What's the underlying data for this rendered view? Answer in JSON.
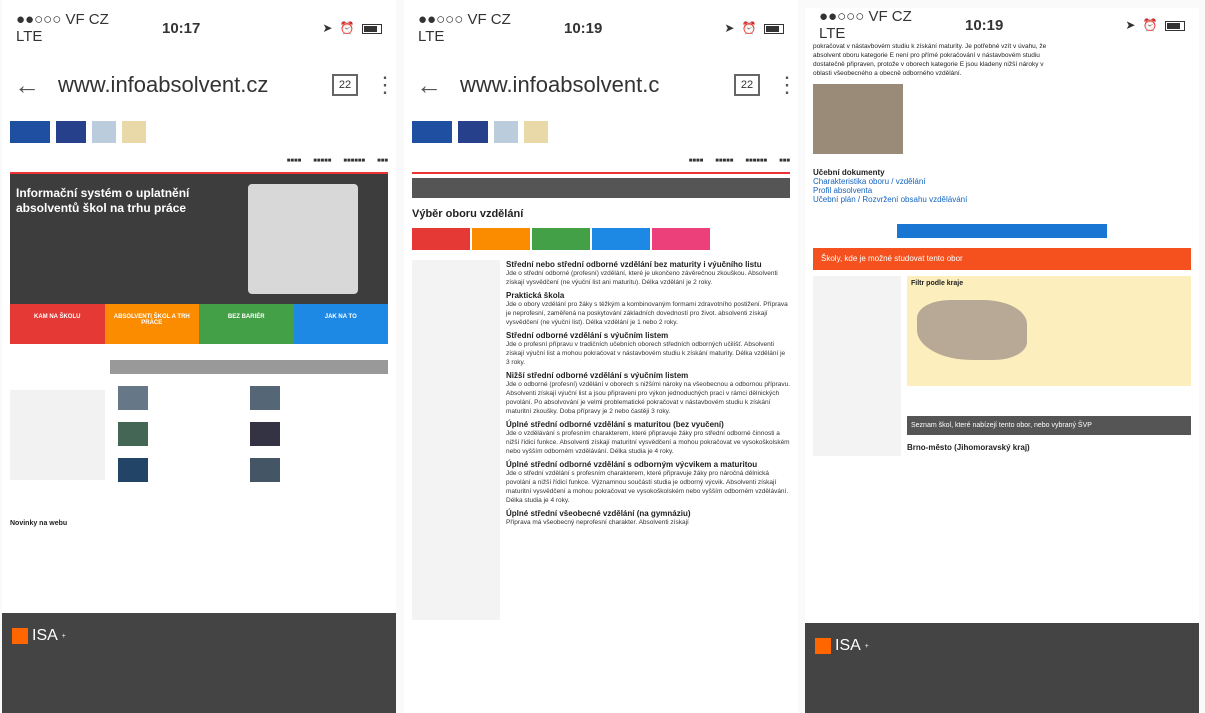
{
  "phones": [
    {
      "status": {
        "carrier": "●●○○○ VF CZ  LTE",
        "time": "10:17"
      },
      "url": "www.infoabsolvent.cz",
      "tabs": "22"
    },
    {
      "status": {
        "carrier": "●●○○○ VF CZ  LTE",
        "time": "10:19"
      },
      "url": "www.infoabsolvent.c",
      "tabs": "22"
    },
    {
      "status": {
        "carrier": "●●○○○ VF CZ  LTE",
        "time": "10:19"
      }
    }
  ],
  "p1": {
    "hero_title": "Informační systém o uplatnění absolventů škol na trhu práce",
    "tiles": [
      {
        "label": "KAM NA ŠKOLU",
        "color": "#e53935"
      },
      {
        "label": "ABSOLVENTI ŠKOL A TRH PRÁCE",
        "color": "#fb8c00"
      },
      {
        "label": "BEZ BARIÉR",
        "color": "#43a047"
      },
      {
        "label": "JAK NA TO",
        "color": "#1e88e5"
      }
    ],
    "news": "Novinky na webu"
  },
  "p2": {
    "heading": "Výběr oboru vzdělání",
    "chips": [
      {
        "color": "#e53935"
      },
      {
        "color": "#fb8c00"
      },
      {
        "color": "#43a047"
      },
      {
        "color": "#1e88e5"
      },
      {
        "color": "#ec407a"
      }
    ],
    "items": [
      {
        "title": "Střední nebo střední odborné vzdělání bez maturity i výučního listu",
        "desc": "Jde o střední odborné (profesní) vzdělání, které je ukončeno závěrečnou zkouškou. Absolventi získají vysvědčení (ne výuční list ani maturitu). Délka vzdělání je 2 roky."
      },
      {
        "title": "Praktická škola",
        "desc": "Jde o obory vzdělání pro žáky s těžkým a kombinovaným formami zdravotního postižení. Příprava je neprofesní, zaměřená na poskytování základních dovedností pro život. absolventi získají vysvědčení (ne výuční list). Délka vzdělání je 1 nebo 2 roky."
      },
      {
        "title": "Střední odborné vzdělání s výučním listem",
        "desc": "Jde o profesní přípravu v tradičních učebních oborech středních odborných učilišť. Absolventi získají výuční list a mohou pokračovat v nástavbovém studiu k získání maturity. Délka vzdělání je 3 roky."
      },
      {
        "title": "Nižší střední odborné vzdělání s výučním listem",
        "desc": "Jde o odborné (profesní) vzdělání v oborech s nižšími nároky na všeobecnou a odbornou přípravu. Absolventi získají výuční list a jsou připraveni pro výkon jednoduchých prací v rámci dělnických povolání. Po absolvování je velmi problematické pokračovat v nástavbovém studiu k získání maturitní zkoušky. Doba přípravy je 2 nebo častěji 3 roky."
      },
      {
        "title": "Úplné střední odborné vzdělání s maturitou (bez vyučení)",
        "desc": "Jde o vzdělávání s profesním charakterem, které připravuje žáky pro střední odborné činnosti a nižší řídicí funkce. Absolventi získají maturitní vysvědčení a mohou pokračovat ve vysokoškolském nebo vyšším odborném vzdělávání. Délka studia je 4 roky."
      },
      {
        "title": "Úplné střední odborné vzdělání s odborným výcvikem a maturitou",
        "desc": "Jde o střední vzdělání s profesním charakterem, které připravuje žáky pro náročná dělnická povolání a nižší řídicí funkce. Významnou součástí studia je odborný výcvik. Absolventi získají maturitní vysvědčení a mohou pokračovat ve vysokoškolském nebo vyšším odborném vzdělávání. Délka studia je 4 roky."
      },
      {
        "title": "Úplné střední všeobecné vzdělání (na gymnáziu)",
        "desc": "Příprava má všeobecný neprofesní charakter. Absolventi získají"
      }
    ]
  },
  "p3": {
    "intro": "pokračovat v nástavbovém studiu k získání maturity. Je potřebné vzít v úvahu, že absolvent oboru kategorie E není pro přímé pokračování v nástavbovém studiu dostatečně připraven, protože v oborech kategorie E jsou kladeny nižší nároky v oblasti všeobecného a obecně odborného vzdělání.",
    "docs_heading": "Učební dokumenty",
    "docs": [
      "Charakteristika oboru / vzdělání",
      "Profil absolventa",
      "Učební plán / Rozvržení obsahu vzdělávání"
    ],
    "orange_bar": "Školy, kde je možné studovat tento obor",
    "map_title": "Filtr podle kraje",
    "dark_bar": "Seznam škol, které nabízejí tento obor, nebo vybraný ŠVP",
    "region": "Brno-město (Jihomoravský kraj)"
  }
}
